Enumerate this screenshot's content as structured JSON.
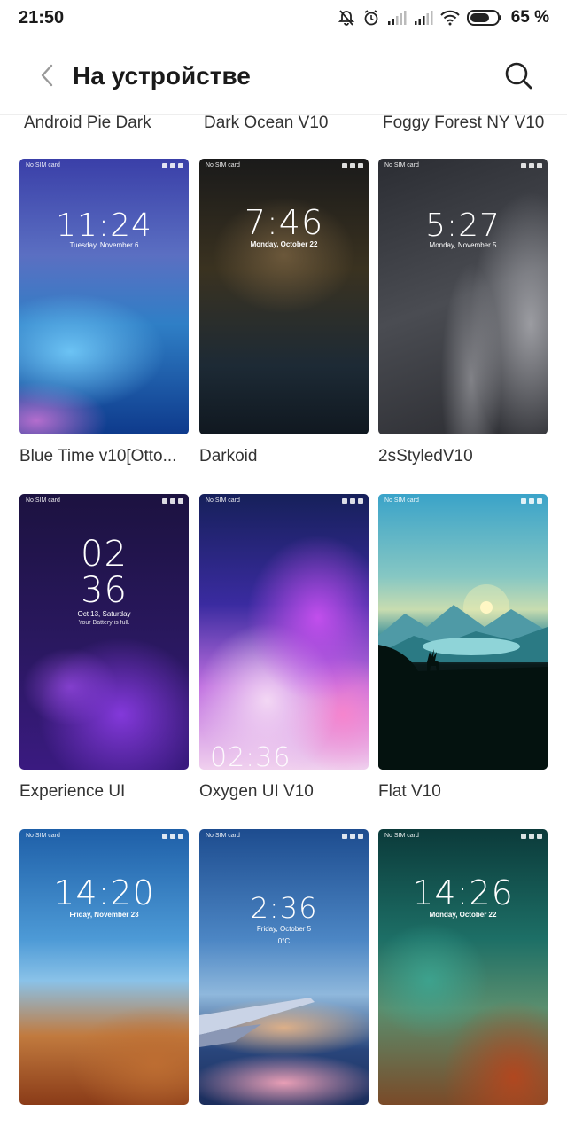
{
  "status_bar": {
    "time": "21:50",
    "battery_percent": "65 %",
    "icons": [
      "mute-bell-icon",
      "alarm-icon",
      "signal-icon",
      "signal-icon",
      "wifi-icon",
      "battery-icon"
    ]
  },
  "header": {
    "title": "На устройстве",
    "back_icon": "chevron-left-icon",
    "search_icon": "search-icon"
  },
  "top_partial_labels": [
    "Android Pie Dark",
    "Dark Ocean V10",
    "Foggy Forest NY V10"
  ],
  "themes": [
    {
      "label": "Blue Time v10[Otto...",
      "clock": "11:24",
      "date": "Tuesday, November 6",
      "sim": "No SIM card"
    },
    {
      "label": "Darkoid",
      "clock": "7:46",
      "date": "Monday, October 22",
      "sim": "No SIM card"
    },
    {
      "label": "2sStyledV10",
      "clock": "5:27",
      "date": "Monday, November 5",
      "sim": "No SIM card"
    },
    {
      "label": "Experience UI",
      "clock_h": "02",
      "clock_m": "36",
      "date": "Oct 13, Saturday",
      "note": "Your Battery is full.",
      "sim": "No SIM card"
    },
    {
      "label": "Oxygen UI V10",
      "clock": "02:36",
      "sim": "No SIM card"
    },
    {
      "label": "Flat V10",
      "sim": "No SIM card"
    },
    {
      "label": "",
      "clock": "14:20",
      "date": "Friday, November 23",
      "sim": "No SIM card"
    },
    {
      "label": "",
      "clock": "2:36",
      "date": "Friday, October 5",
      "temp": "0°C",
      "sim": "No SIM card"
    },
    {
      "label": "",
      "clock": "14:26",
      "date": "Monday, October 22",
      "sim": "No SIM card"
    }
  ],
  "colors": {
    "accent_text": "#222222",
    "background": "#ffffff"
  }
}
